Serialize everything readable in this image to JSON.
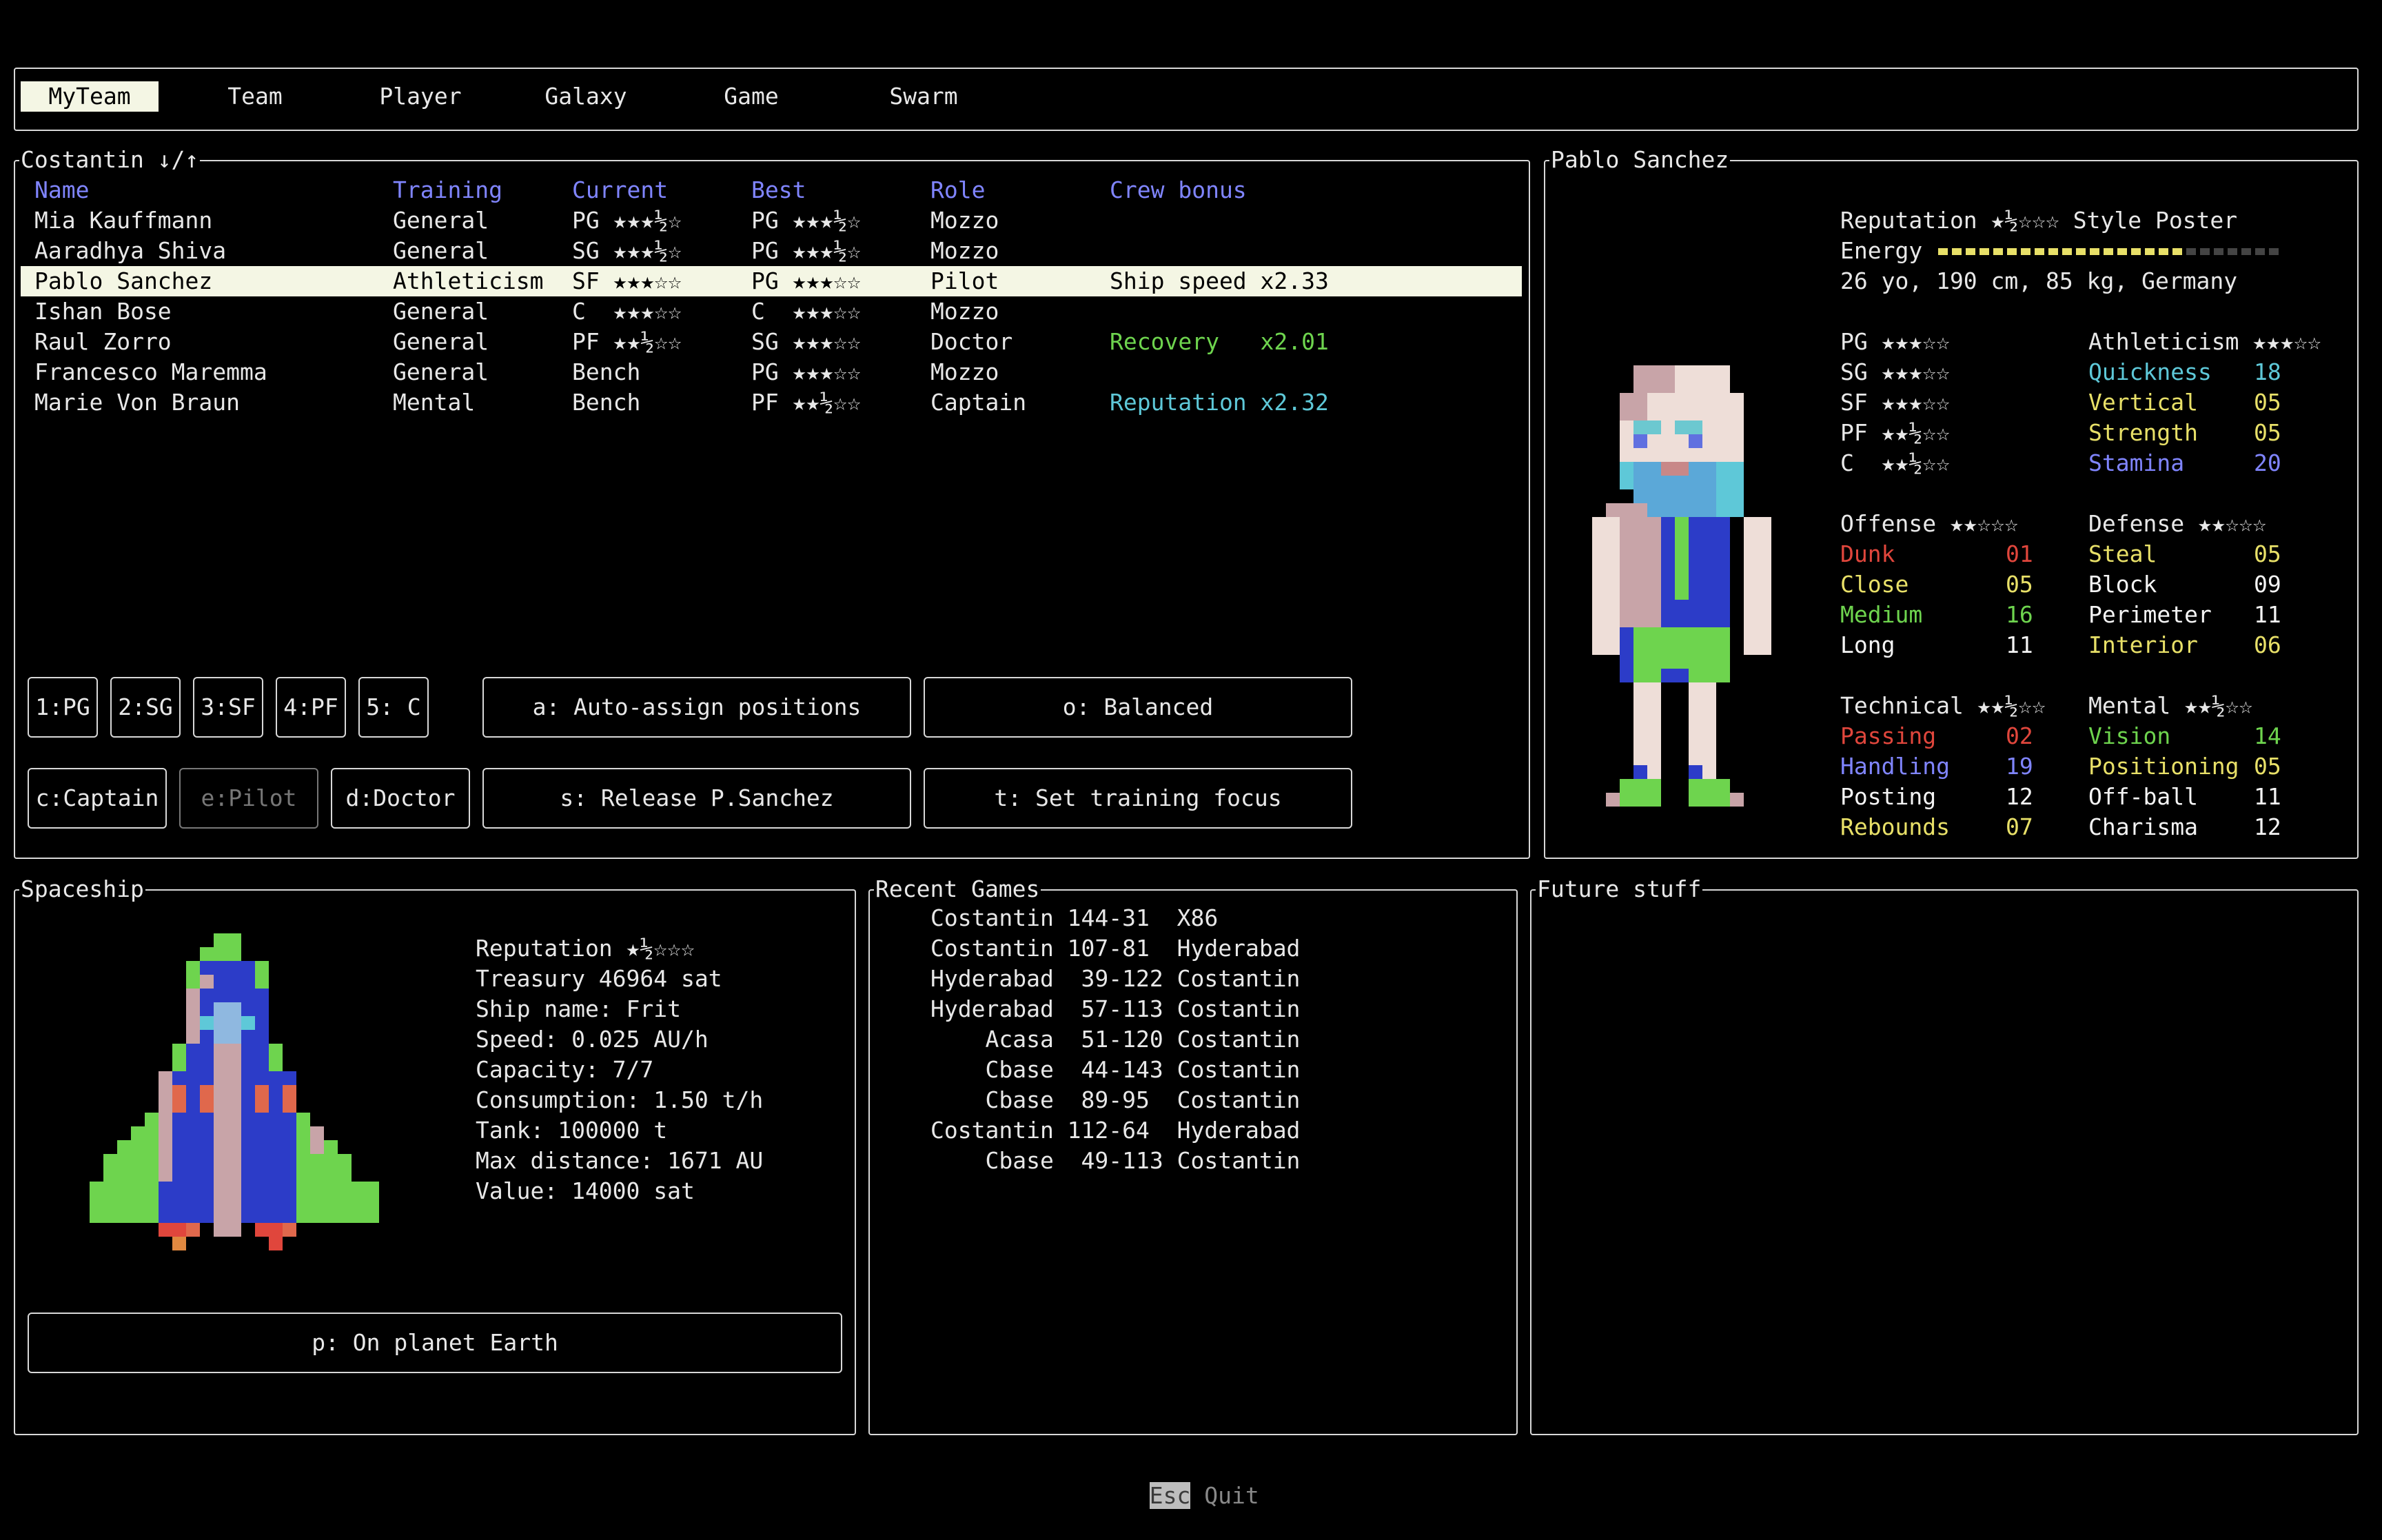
{
  "tabs": [
    {
      "label": "MyTeam",
      "active": true
    },
    {
      "label": "Team",
      "active": false
    },
    {
      "label": "Player",
      "active": false
    },
    {
      "label": "Galaxy",
      "active": false
    },
    {
      "label": "Game",
      "active": false
    },
    {
      "label": "Swarm",
      "active": false
    }
  ],
  "roster": {
    "title": "Costantin ↓/↑",
    "headers": {
      "name": "Name",
      "training": "Training",
      "current": "Current",
      "best": "Best",
      "role": "Role",
      "crew_bonus": "Crew bonus"
    },
    "rows": [
      {
        "name": "Mia Kauffmann",
        "training": "General",
        "current": "PG ★★★½☆",
        "best": "PG ★★★½☆",
        "role": "Mozzo",
        "crew_bonus": "",
        "bonus_color": ""
      },
      {
        "name": "Aaradhya Shiva",
        "training": "General",
        "current": "SG ★★★½☆",
        "best": "PG ★★★½☆",
        "role": "Mozzo",
        "crew_bonus": "",
        "bonus_color": ""
      },
      {
        "name": "Pablo Sanchez",
        "training": "Athleticism",
        "current": "SF ★★★☆☆",
        "best": "PG ★★★☆☆",
        "role": "Pilot",
        "crew_bonus": "Ship speed x2.33",
        "bonus_color": "selected"
      },
      {
        "name": "Ishan Bose",
        "training": "General",
        "current": "C  ★★★☆☆",
        "best": "C  ★★★☆☆",
        "role": "Mozzo",
        "crew_bonus": "",
        "bonus_color": ""
      },
      {
        "name": "Raul Zorro",
        "training": "General",
        "current": "PF ★★½☆☆",
        "best": "SG ★★★☆☆",
        "role": "Doctor",
        "crew_bonus": "Recovery   x2.01",
        "bonus_color": "green"
      },
      {
        "name": "Francesco Maremma",
        "training": "General",
        "current": "Bench",
        "best": "PG ★★★☆☆",
        "role": "Mozzo",
        "crew_bonus": "",
        "bonus_color": ""
      },
      {
        "name": "Marie Von Braun",
        "training": "Mental",
        "current": "Bench",
        "best": "PF ★★½☆☆",
        "role": "Captain",
        "crew_bonus": "Reputation x2.32",
        "bonus_color": "cyan"
      }
    ],
    "position_buttons": [
      "1:PG",
      "2:SG",
      "3:SF",
      "4:PF",
      "5: C"
    ],
    "auto_assign": "a: Auto-assign positions",
    "tactic": "o: Balanced",
    "captain_button": "c:Captain",
    "pilot_button": "e:Pilot",
    "doctor_button": "d:Doctor",
    "release_button": "s: Release P.Sanchez",
    "training_button": "t: Set training focus"
  },
  "player": {
    "title": "Pablo Sanchez",
    "reputation": "Reputation ★½☆☆☆ Style Poster",
    "energy_label": "Energy",
    "energy_fraction": 0.72,
    "bio": "26 yo, 190 cm, 85 kg, Germany",
    "positions": [
      "PG ★★★☆☆",
      "SG ★★★☆☆",
      "SF ★★★☆☆",
      "PF ★★½☆☆",
      "C  ★★½☆☆"
    ],
    "athleticism": {
      "header": "Athleticism ★★★☆☆",
      "skills": [
        {
          "name": "Quickness",
          "value": "18",
          "color": "cyan"
        },
        {
          "name": "Vertical",
          "value": "05",
          "color": "yellow"
        },
        {
          "name": "Strength",
          "value": "05",
          "color": "yellow"
        },
        {
          "name": "Stamina",
          "value": "20",
          "color": "blue"
        }
      ]
    },
    "offense": {
      "header": "Offense ★★☆☆☆",
      "skills": [
        {
          "name": "Dunk",
          "value": "01",
          "color": "red"
        },
        {
          "name": "Close",
          "value": "05",
          "color": "yellow"
        },
        {
          "name": "Medium",
          "value": "16",
          "color": "green"
        },
        {
          "name": "Long",
          "value": "11",
          "color": "white"
        }
      ]
    },
    "defense": {
      "header": "Defense ★★☆☆☆",
      "skills": [
        {
          "name": "Steal",
          "value": "05",
          "color": "yellow"
        },
        {
          "name": "Block",
          "value": "09",
          "color": "white"
        },
        {
          "name": "Perimeter",
          "value": "11",
          "color": "white"
        },
        {
          "name": "Interior",
          "value": "06",
          "color": "yellow"
        }
      ]
    },
    "technical": {
      "header": "Technical ★★½☆☆",
      "skills": [
        {
          "name": "Passing",
          "value": "02",
          "color": "red"
        },
        {
          "name": "Handling",
          "value": "19",
          "color": "blue"
        },
        {
          "name": "Posting",
          "value": "12",
          "color": "white"
        },
        {
          "name": "Rebounds",
          "value": "07",
          "color": "yellow"
        }
      ]
    },
    "mental": {
      "header": "Mental ★★½☆☆",
      "skills": [
        {
          "name": "Vision",
          "value": "14",
          "color": "green"
        },
        {
          "name": "Positioning",
          "value": "05",
          "color": "yellow"
        },
        {
          "name": "Off-ball",
          "value": "11",
          "color": "white"
        },
        {
          "name": "Charisma",
          "value": "12",
          "color": "white"
        }
      ]
    }
  },
  "spaceship": {
    "title": "Spaceship",
    "lines": [
      "Reputation ★½☆☆☆",
      "Treasury 46964 sat",
      "Ship name: Frit",
      "Speed: 0.025 AU/h",
      "Capacity: 7/7",
      "Consumption: 1.50 t/h",
      "Tank: 100000 t",
      "Max distance: 1671 AU",
      "Value: 14000 sat"
    ],
    "location_button": "p: On planet Earth"
  },
  "recent_games": {
    "title": "Recent Games",
    "games": [
      "Costantin 144-31  X86",
      "Costantin 107-81  Hyderabad",
      "Hyderabad  39-122 Costantin",
      "Hyderabad  57-113 Costantin",
      "    Acasa  51-120 Costantin",
      "    Cbase  44-143 Costantin",
      "    Cbase  89-95  Costantin",
      "Costantin 112-64  Hyderabad",
      "    Cbase  49-113 Costantin"
    ]
  },
  "future": {
    "title": "Future stuff"
  },
  "footer": {
    "esc": "Esc",
    "quit": " Quit"
  },
  "colors": {
    "blue": "#8085ff",
    "cyan": "#5ec8d8",
    "green": "#6ed44e",
    "red": "#e0463c",
    "yellow": "#e8e068",
    "white": "#f4f4f4"
  }
}
